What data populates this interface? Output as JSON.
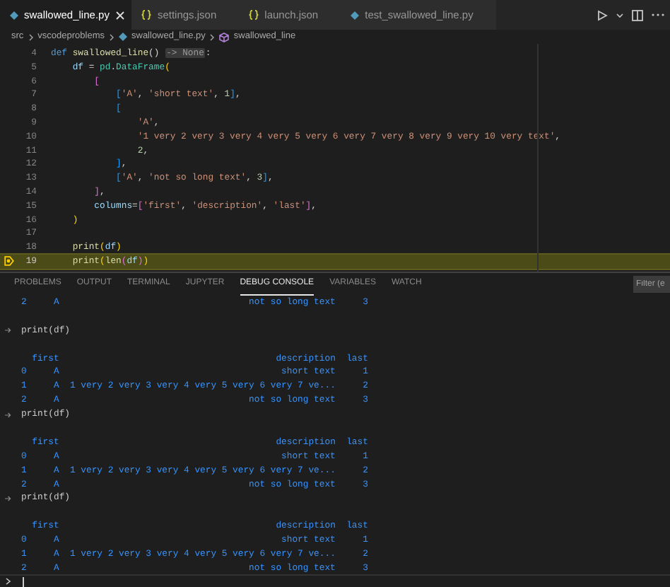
{
  "tabs": [
    {
      "label": "swallowed_line.py",
      "kind": "python",
      "selected": true
    },
    {
      "label": "settings.json",
      "kind": "json",
      "selected": false
    },
    {
      "label": "launch.json",
      "kind": "json",
      "selected": false
    },
    {
      "label": "test_swallowed_line.py",
      "kind": "python",
      "selected": false
    }
  ],
  "breadcrumb": [
    {
      "label": "src"
    },
    {
      "label": "vscodeproblems"
    },
    {
      "label": "swallowed_line.py",
      "kind": "python"
    },
    {
      "label": "swallowed_line",
      "kind": "symbol"
    }
  ],
  "editor": {
    "lines": [
      {
        "number": "4",
        "current": false,
        "tokens": [
          {
            "kind": "kw",
            "text": "def "
          },
          {
            "kind": "fn",
            "text": "swallowed_line"
          },
          {
            "kind": "op",
            "text": "() "
          },
          {
            "kind": "hint",
            "text": "-> None"
          },
          {
            "kind": "op",
            "text": ":"
          }
        ]
      },
      {
        "number": "5",
        "current": false,
        "tokens": [
          {
            "kind": "var",
            "text": "    df"
          },
          {
            "kind": "op",
            "text": " = "
          },
          {
            "kind": "cls",
            "text": "pd"
          },
          {
            "kind": "op",
            "text": "."
          },
          {
            "kind": "cls",
            "text": "DataFrame"
          },
          {
            "kind": "b1",
            "text": "("
          }
        ]
      },
      {
        "number": "6",
        "current": false,
        "tokens": [
          {
            "kind": "b2",
            "text": "        ["
          }
        ]
      },
      {
        "number": "7",
        "current": false,
        "tokens": [
          {
            "kind": "b3",
            "text": "            ["
          },
          {
            "kind": "str",
            "text": "'A'"
          },
          {
            "kind": "op",
            "text": ", "
          },
          {
            "kind": "str",
            "text": "'short text'"
          },
          {
            "kind": "op",
            "text": ", "
          },
          {
            "kind": "num",
            "text": "1"
          },
          {
            "kind": "b3",
            "text": "]"
          },
          {
            "kind": "op",
            "text": ","
          }
        ]
      },
      {
        "number": "8",
        "current": false,
        "tokens": [
          {
            "kind": "b3",
            "text": "            ["
          }
        ]
      },
      {
        "number": "9",
        "current": false,
        "tokens": [
          {
            "kind": "str",
            "text": "                'A'"
          },
          {
            "kind": "op",
            "text": ","
          }
        ]
      },
      {
        "number": "10",
        "current": false,
        "tokens": [
          {
            "kind": "str",
            "text": "                '1 very 2 very 3 very 4 very 5 very 6 very 7 very 8 very 9 very 10 very text'"
          },
          {
            "kind": "op",
            "text": ","
          }
        ]
      },
      {
        "number": "11",
        "current": false,
        "tokens": [
          {
            "kind": "num",
            "text": "                2"
          },
          {
            "kind": "op",
            "text": ","
          }
        ]
      },
      {
        "number": "12",
        "current": false,
        "tokens": [
          {
            "kind": "b3",
            "text": "            ]"
          },
          {
            "kind": "op",
            "text": ","
          }
        ]
      },
      {
        "number": "13",
        "current": false,
        "tokens": [
          {
            "kind": "b3",
            "text": "            ["
          },
          {
            "kind": "str",
            "text": "'A'"
          },
          {
            "kind": "op",
            "text": ", "
          },
          {
            "kind": "str",
            "text": "'not so long text'"
          },
          {
            "kind": "op",
            "text": ", "
          },
          {
            "kind": "num",
            "text": "3"
          },
          {
            "kind": "b3",
            "text": "]"
          },
          {
            "kind": "op",
            "text": ","
          }
        ]
      },
      {
        "number": "14",
        "current": false,
        "tokens": [
          {
            "kind": "b2",
            "text": "        ]"
          },
          {
            "kind": "op",
            "text": ","
          }
        ]
      },
      {
        "number": "15",
        "current": false,
        "tokens": [
          {
            "kind": "var",
            "text": "        columns"
          },
          {
            "kind": "op",
            "text": "="
          },
          {
            "kind": "b2",
            "text": "["
          },
          {
            "kind": "str",
            "text": "'first'"
          },
          {
            "kind": "op",
            "text": ", "
          },
          {
            "kind": "str",
            "text": "'description'"
          },
          {
            "kind": "op",
            "text": ", "
          },
          {
            "kind": "str",
            "text": "'last'"
          },
          {
            "kind": "b2",
            "text": "]"
          },
          {
            "kind": "op",
            "text": ","
          }
        ]
      },
      {
        "number": "16",
        "current": false,
        "tokens": [
          {
            "kind": "b1",
            "text": "    )"
          }
        ]
      },
      {
        "number": "17",
        "current": false
      },
      {
        "number": "18",
        "current": false,
        "tokens": [
          {
            "kind": "fn",
            "text": "    print"
          },
          {
            "kind": "b1",
            "text": "("
          },
          {
            "kind": "var",
            "text": "df"
          },
          {
            "kind": "b1",
            "text": ")"
          }
        ]
      },
      {
        "number": "19",
        "current": true,
        "tokens": [
          {
            "kind": "fn",
            "text": "    print"
          },
          {
            "kind": "b1",
            "text": "("
          },
          {
            "kind": "fn",
            "text": "len"
          },
          {
            "kind": "b2",
            "text": "("
          },
          {
            "kind": "var",
            "text": "df"
          },
          {
            "kind": "b2",
            "text": ")"
          },
          {
            "kind": "b1",
            "text": ")"
          }
        ]
      }
    ]
  },
  "panel": {
    "tabs": [
      {
        "label": "PROBLEMS",
        "selected": false
      },
      {
        "label": "OUTPUT",
        "selected": false
      },
      {
        "label": "TERMINAL",
        "selected": false
      },
      {
        "label": "JUPYTER",
        "selected": false
      },
      {
        "label": "DEBUG CONSOLE",
        "selected": true
      },
      {
        "label": "VARIABLES",
        "selected": false
      },
      {
        "label": "WATCH",
        "selected": false
      }
    ],
    "filter": {
      "placeholder": "Filter (e"
    },
    "console": [
      {
        "kind": "table",
        "rows": [
          {
            "index": "2",
            "cells": [
              "A",
              "not so long text",
              "3"
            ]
          }
        ]
      },
      {
        "kind": "blank"
      },
      {
        "kind": "input",
        "text": "print(df)"
      },
      {
        "kind": "blank"
      },
      {
        "kind": "table",
        "columns": [
          "first",
          "description",
          "last"
        ],
        "rows": [
          {
            "index": "0",
            "cells": [
              "A",
              "short text",
              "1"
            ]
          },
          {
            "index": "1",
            "cells": [
              "A",
              "1 very 2 very 3 very 4 very 5 very 6 very 7 ve...",
              "2"
            ]
          },
          {
            "index": "2",
            "cells": [
              "A",
              "not so long text",
              "3"
            ]
          }
        ]
      },
      {
        "kind": "input",
        "text": "print(df)"
      },
      {
        "kind": "blank"
      },
      {
        "kind": "table",
        "columns": [
          "first",
          "description",
          "last"
        ],
        "rows": [
          {
            "index": "0",
            "cells": [
              "A",
              "short text",
              "1"
            ]
          },
          {
            "index": "1",
            "cells": [
              "A",
              "1 very 2 very 3 very 4 very 5 very 6 very 7 ve...",
              "2"
            ]
          },
          {
            "index": "2",
            "cells": [
              "A",
              "not so long text",
              "3"
            ]
          }
        ]
      },
      {
        "kind": "input",
        "text": "print(df)"
      },
      {
        "kind": "blank"
      },
      {
        "kind": "table",
        "columns": [
          "first",
          "description",
          "last"
        ],
        "rows": [
          {
            "index": "0",
            "cells": [
              "A",
              "short text",
              "1"
            ]
          },
          {
            "index": "1",
            "cells": [
              "A",
              "1 very 2 very 3 very 4 very 5 very 6 very 7 ve...",
              "2"
            ]
          },
          {
            "index": "2",
            "cells": [
              "A",
              "not so long text",
              "3"
            ]
          }
        ]
      }
    ]
  }
}
